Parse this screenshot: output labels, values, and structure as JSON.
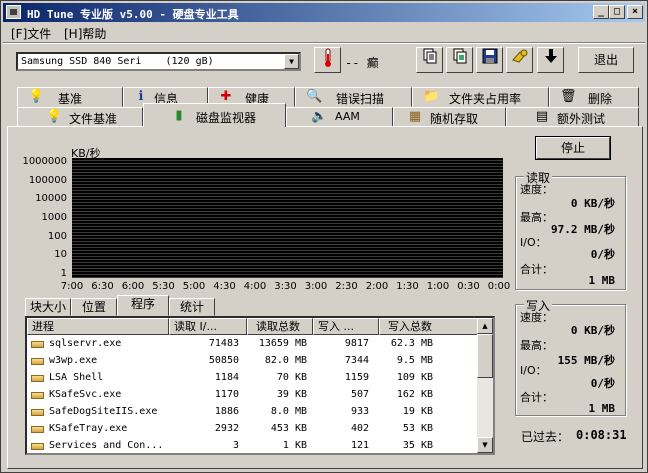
{
  "window": {
    "title": "HD Tune 专业版 v5.00 - 硬盘专业工具",
    "controls": {
      "minimize": "_",
      "maximize": "□",
      "close": "×"
    }
  },
  "menu": [
    {
      "label": "[F]文件"
    },
    {
      "label": "[H]帮助"
    }
  ],
  "toolbar": {
    "drive_select": "Samsung SSD 840 Seri    (120 gB)",
    "temperature": "-- 癫",
    "exit_label": "退出",
    "icons": [
      "thermometer-icon",
      "copy-info-icon",
      "copy-screen-icon",
      "save-icon",
      "options-icon",
      "down-arrow-icon"
    ]
  },
  "tabs_row1": [
    {
      "label": "基准",
      "icon": "lightbulb-icon",
      "glyph": "💡"
    },
    {
      "label": "信息",
      "icon": "info-icon",
      "glyph": "ℹ"
    },
    {
      "label": "健康",
      "icon": "health-cross-icon",
      "glyph": "✚"
    },
    {
      "label": "错误扫描",
      "icon": "magnifier-icon",
      "glyph": "🔍"
    },
    {
      "label": "文件夹占用率",
      "icon": "folder-icon",
      "glyph": "📁"
    },
    {
      "label": "删除",
      "icon": "trash-icon",
      "glyph": "🗑"
    }
  ],
  "tabs_row2": [
    {
      "label": "文件基准",
      "icon": "file-bench-icon",
      "glyph": "💡"
    },
    {
      "label": "磁盘监视器",
      "icon": "monitor-chart-icon",
      "glyph": "▮",
      "active": true
    },
    {
      "label": "AAM",
      "icon": "speaker-icon",
      "glyph": "🔈"
    },
    {
      "label": "随机存取",
      "icon": "random-access-icon",
      "glyph": "▦"
    },
    {
      "label": "额外测试",
      "icon": "extra-test-icon",
      "glyph": "▤"
    }
  ],
  "monitor": {
    "stop_label": "停止",
    "elapsed_label": "已过去：",
    "elapsed_value": "0:08:31"
  },
  "chart_data": {
    "type": "line",
    "ylabel": "KB/秒",
    "yscale": "log",
    "yticks": [
      "1000000",
      "100000",
      "10000",
      "1000",
      "100",
      "10",
      "1"
    ],
    "xticks": [
      "7:00",
      "6:30",
      "6:00",
      "5:30",
      "5:00",
      "4:30",
      "4:00",
      "3:30",
      "3:00",
      "2:30",
      "2:00",
      "1:30",
      "1:00",
      "0:30",
      "0:00"
    ],
    "ylim": [
      1,
      1000000
    ],
    "background": "#000000",
    "series": []
  },
  "read_group": {
    "title": "读取",
    "speed_label": "速度：",
    "speed_value": "0 KB/秒",
    "max_label": "最高：",
    "max_value": "97.2 MB/秒",
    "io_label": "I/O：",
    "io_value": "0/秒",
    "total_label": "合计：",
    "total_value": "1 MB"
  },
  "write_group": {
    "title": "写入",
    "speed_label": "速度：",
    "speed_value": "0 KB/秒",
    "max_label": "最高：",
    "max_value": "155 MB/秒",
    "io_label": "I/O：",
    "io_value": "0/秒",
    "total_label": "合计：",
    "total_value": "1 MB"
  },
  "subtabs": [
    {
      "label": "块大小"
    },
    {
      "label": "位置"
    },
    {
      "label": "程序",
      "active": true
    },
    {
      "label": "统计"
    }
  ],
  "process_list": {
    "headers": [
      "进程",
      "读取 I/...",
      "读取总数",
      "写入 ...",
      "写入总数"
    ],
    "rows": [
      {
        "name": "sqlservr.exe",
        "read_io": "71483",
        "read_total": "13659 MB",
        "write_io": "9817",
        "write_total": "62.3 MB"
      },
      {
        "name": "w3wp.exe",
        "read_io": "50850",
        "read_total": "82.0 MB",
        "write_io": "7344",
        "write_total": "9.5 MB"
      },
      {
        "name": "LSA Shell",
        "read_io": "1184",
        "read_total": "70 KB",
        "write_io": "1159",
        "write_total": "109 KB"
      },
      {
        "name": "KSafeSvc.exe",
        "read_io": "1170",
        "read_total": "39 KB",
        "write_io": "507",
        "write_total": "162 KB"
      },
      {
        "name": "SafeDogSiteIIS.exe",
        "read_io": "1886",
        "read_total": "8.0 MB",
        "write_io": "933",
        "write_total": "19 KB"
      },
      {
        "name": "KSafeTray.exe",
        "read_io": "2932",
        "read_total": "453 KB",
        "write_io": "402",
        "write_total": "53 KB"
      },
      {
        "name": "Services and Con...",
        "read_io": "3",
        "read_total": "1 KB",
        "write_io": "121",
        "write_total": "35 KB"
      }
    ]
  }
}
